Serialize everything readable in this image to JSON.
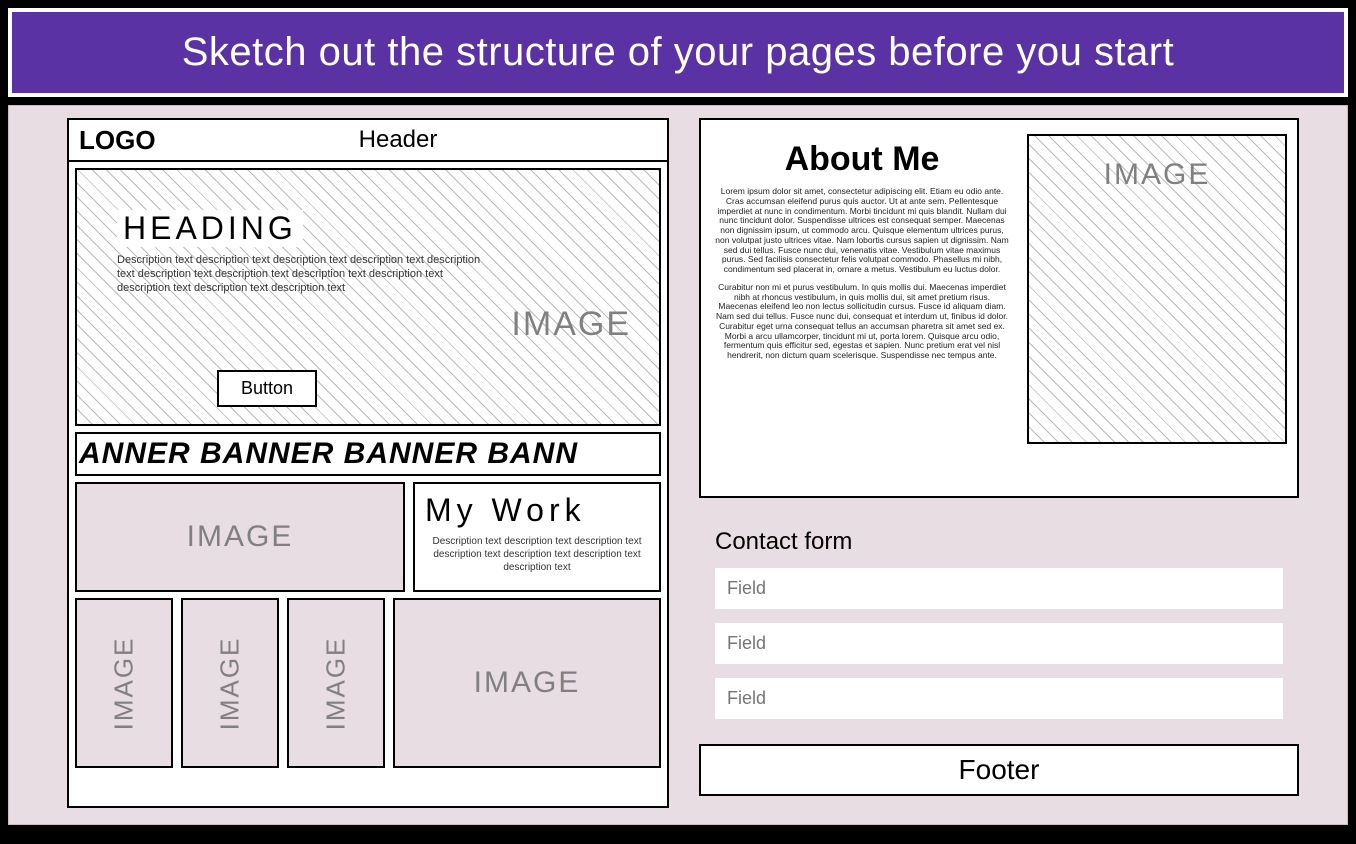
{
  "title": "Sketch out the structure of your pages before you start",
  "left": {
    "logo": "LOGO",
    "header": "Header",
    "heroHeading": "HEADING",
    "heroDesc": "Description text description text description text description text description text description text description text description text description text description text description text description text",
    "heroBtn": "Button",
    "heroImageLabel": "IMAGE",
    "banner": "ANNER BANNER BANNER BANN",
    "workImgLabel": "IMAGE",
    "workTitle": "My Work",
    "workDesc": "Description text description text description text description text description text description text description text",
    "thumbLabel": "IMAGE",
    "bigThumbLabel": "IMAGE"
  },
  "right": {
    "aboutTitle": "About Me",
    "aboutPara1": "Lorem ipsum dolor sit amet, consectetur adipiscing elit. Etiam eu odio ante. Cras accumsan eleifend purus quis auctor. Ut at ante sem. Pellentesque imperdiet at nunc in condimentum. Morbi tincidunt mi quis blandit. Nullam dui nunc tincidunt dolor. Suspendisse ultrices est consequat semper. Maecenas non dignissim ipsum, ut commodo arcu. Quisque elementum ultrices purus, non volutpat justo ultrices vitae. Nam lobortis cursus sapien ut dignissim. Nam sed dui tellus. Fusce nunc dui, venenatis vitae. Vestibulum vitae maximus purus. Sed facilisis consectetur felis volutpat commodo. Phasellus mi nibh, condimentum sed placerat in, ornare a metus. Vestibulum eu luctus dolor.",
    "aboutPara2": "Curabitur non mi et purus vestibulum. In quis mollis dui. Maecenas imperdiet nibh at rhoncus vestibulum, in quis mollis dui, sit amet pretium risus. Maecenas eleifend leo non lectus sollicitudin cursus. Fusce id aliquam diam. Nam sed dui tellus. Fusce nunc dui, consequat et interdum ut, finibus id dolor. Curabitur eget urna consequat tellus an accumsan pharetra sit amet sed ex. Morbi a arcu ullamcorper, tincidunt mi ut, porta lorem. Quisque arcu odio, fermentum quis efficitur sed, egestas et sapien. Nunc pretium erat vel nisl hendrerit, non dictum quam scelerisque. Suspendisse nec tempus ante.",
    "aboutImgLabel": "IMAGE",
    "contactTitle": "Contact form",
    "fieldPlaceholder": "Field",
    "footer": "Footer"
  }
}
